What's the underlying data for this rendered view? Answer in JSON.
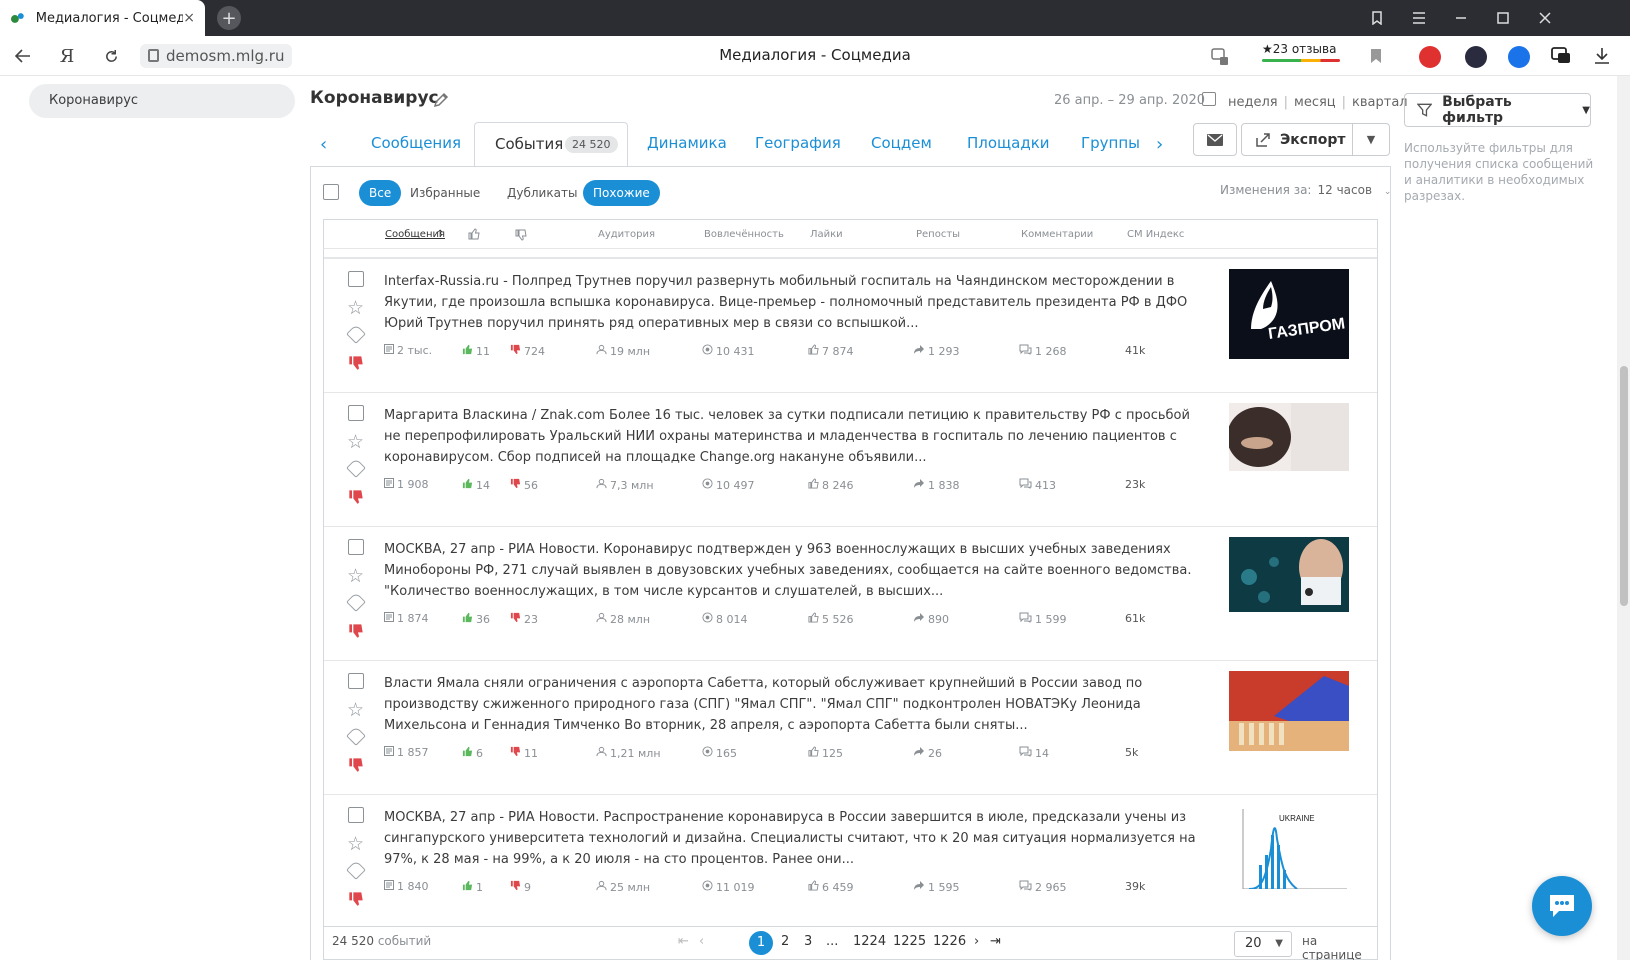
{
  "browser": {
    "tab_title": "Медиалогия - Соцмедиа",
    "tab_close": "×",
    "new_tab": "+",
    "url": "demosm.mlg.ru",
    "page_title": "Медиалогия - Соцмедиа",
    "reviews": "★23 отзыва",
    "yandex_btn": "Я"
  },
  "sidebar": {
    "item": "Коронавирус"
  },
  "header": {
    "title": "Коронавирус",
    "dates": "26 апр. – 29 апр. 2020",
    "periods": [
      "неделя",
      "месяц",
      "квартал"
    ],
    "filter_button": "Выбрать фильтр",
    "filter_hint": "Используйте фильтры для получения списка сообщений и аналитики в необходимых разрезах."
  },
  "tabs": {
    "items": [
      "Сообщения",
      "События",
      "Динамика",
      "География",
      "Соцдем",
      "Площадки",
      "Группы"
    ],
    "active_badge": "24 520",
    "export": "Экспорт"
  },
  "toolbar": {
    "chips": [
      "Все",
      "Избранные",
      "Дубликаты",
      "Похожие"
    ],
    "changes_label": "Изменения за:",
    "changes_value": "12 часов"
  },
  "columns": [
    "Сообщения",
    "Аудитория",
    "Вовлечённость",
    "Лайки",
    "Репосты",
    "Комментарии",
    "СМ Индекс"
  ],
  "rows": [
    {
      "text": "Interfax-Russia.ru - Полпред Трутнев поручил развернуть мобильный госпиталь на Чаяндинском месторождении в Якутии, где произошла вспышка коронавируса. Вице-премьер - полномочный представитель президента РФ в ДФО Юрий Трутнев поручил принять ряд оперативных мер в связи со вспышкой...",
      "messages": "2 тыс.",
      "likes_up": "11",
      "likes_down": "724",
      "audience": "19 млн",
      "engagement": "10 431",
      "likes": "7 874",
      "reposts": "1 293",
      "comments": "1 268",
      "index": "41k",
      "thumb": "gazprom"
    },
    {
      "text": "Маргарита Власкина / Znak.com Более 16 тыс. человек за сутки подписали петицию к правительству РФ с просьбой не перепрофилировать Уральский НИИ охраны материнства и младенчества в госпиталь по лечению пациентов с коронавирусом. Сбор подписей на площадке Change.org накануне объявили...",
      "messages": "1 908",
      "likes_up": "14",
      "likes_down": "56",
      "audience": "7,3 млн",
      "engagement": "10 497",
      "likes": "8 246",
      "reposts": "1 838",
      "comments": "413",
      "index": "23k",
      "thumb": "pregnant"
    },
    {
      "text": "МОСКВА, 27 апр - РИА Новости. Коронавирус подтвержден у 963 военнослужащих в высших учебных заведениях Минобороны РФ, 271 случай выявлен в довузовских учебных заведениях, сообщается на сайте военного ведомства. \"Количество военнослужащих, в том числе курсантов и слушателей, в высших...",
      "messages": "1 874",
      "likes_up": "36",
      "likes_down": "23",
      "audience": "28 млн",
      "engagement": "8 014",
      "likes": "5 526",
      "reposts": "890",
      "comments": "1 599",
      "index": "61k",
      "thumb": "mask"
    },
    {
      "text": "Власти Ямала сняли ограничения с аэропорта Сабетта, который обслуживает крупнейший в России завод по производству сжиженного природного газа (СПГ) \"Ямал СПГ\". \"Ямал СПГ\" подконтролен НОВАТЭКу Леонида Михельсона и Геннадия Тимченко Во вторник, 28 апреля, с аэропорта Сабетта были сняты...",
      "messages": "1 857",
      "likes_up": "6",
      "likes_down": "11",
      "audience": "1,21 млн",
      "engagement": "165",
      "likes": "125",
      "reposts": "26",
      "comments": "14",
      "index": "5k",
      "thumb": "lab"
    },
    {
      "text": "МОСКВА, 27 апр - РИА Новости. Распространение коронавируса в России завершится в июле, предсказали учены из сингапурского университета технологий и дизайна. Специалисты считают, что к 20 мая ситуация нормализуется на 97%, к 28 мая - на 99%, а к 20 июля - на сто процентов. Ранее они...",
      "messages": "1 840",
      "likes_up": "1",
      "likes_down": "9",
      "audience": "25 млн",
      "engagement": "11 019",
      "likes": "6 459",
      "reposts": "1 595",
      "comments": "2 965",
      "index": "39k",
      "thumb": "chart",
      "thumb_label": "UKRAINE"
    }
  ],
  "footer": {
    "total": "24 520",
    "total_suffix": "событий",
    "pages": [
      "1",
      "2",
      "3",
      "...",
      "1224",
      "1225",
      "1226"
    ],
    "per_page": "20",
    "per_page_label": "на странице"
  },
  "colors": {
    "accent": "#1a8fd6",
    "like": "#5cb85c",
    "dislike": "#e0474c"
  }
}
